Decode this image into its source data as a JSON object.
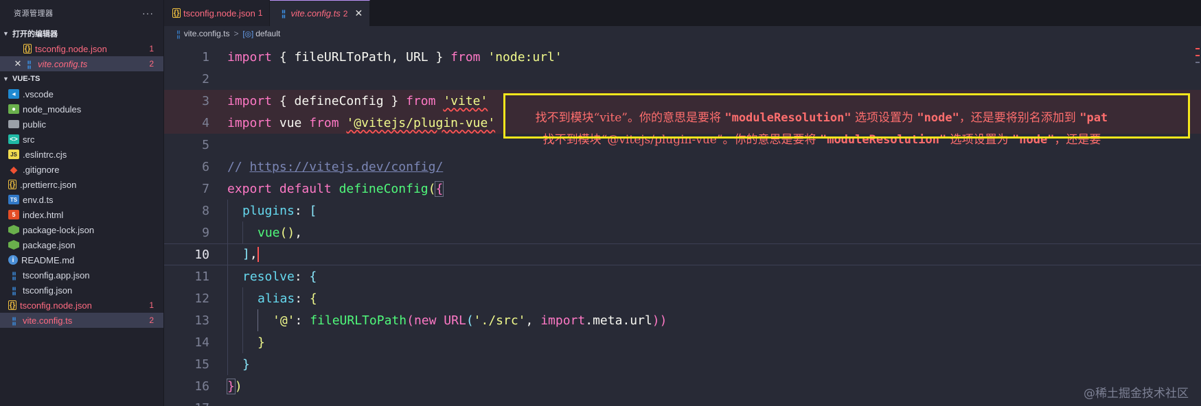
{
  "sidebar": {
    "title": "资源管理器",
    "more_icon": "···",
    "open_editors": {
      "label": "打开的编辑器",
      "items": [
        {
          "name": "tsconfig.node.json",
          "badge": "1",
          "icon": "json-icon",
          "glyph": "{}",
          "style": "err"
        },
        {
          "name": "vite.config.ts",
          "badge": "2",
          "icon": "tsconfig-icon",
          "glyph": "¦¦",
          "style": "err italic",
          "active": true,
          "close": "✕"
        }
      ]
    },
    "project": {
      "label": "VUE-TS",
      "items": [
        {
          "name": ".vscode",
          "icon": "vscode-icon",
          "glyph": "◂"
        },
        {
          "name": "node_modules",
          "icon": "node-modules-icon",
          "glyph": "●"
        },
        {
          "name": "public",
          "icon": "folder-icon",
          "glyph": ""
        },
        {
          "name": "src",
          "icon": "src-folder-icon",
          "glyph": "<>"
        },
        {
          "name": ".eslintrc.cjs",
          "icon": "js-icon",
          "glyph": "JS"
        },
        {
          "name": ".gitignore",
          "icon": "git-icon",
          "glyph": "◆"
        },
        {
          "name": ".prettierrc.json",
          "icon": "json-icon",
          "glyph": "{}"
        },
        {
          "name": "env.d.ts",
          "icon": "typescript-icon",
          "glyph": "TS"
        },
        {
          "name": "index.html",
          "icon": "html-icon",
          "glyph": "5"
        },
        {
          "name": "package-lock.json",
          "icon": "npm-icon",
          "glyph": ""
        },
        {
          "name": "package.json",
          "icon": "npm-icon",
          "glyph": ""
        },
        {
          "name": "README.md",
          "icon": "info-icon",
          "glyph": "i"
        },
        {
          "name": "tsconfig.app.json",
          "icon": "tsconfig-icon",
          "glyph": "¦¦"
        },
        {
          "name": "tsconfig.json",
          "icon": "tsconfig-icon",
          "glyph": "¦¦"
        },
        {
          "name": "tsconfig.node.json",
          "icon": "json-icon",
          "glyph": "{}",
          "badge": "1",
          "style": "err"
        },
        {
          "name": "vite.config.ts",
          "icon": "tsconfig-icon",
          "glyph": "¦¦",
          "badge": "2",
          "style": "err",
          "active": true
        }
      ]
    }
  },
  "tabs": [
    {
      "name": "tsconfig.node.json",
      "badge": "1",
      "icon": "json-icon",
      "glyph": "{}",
      "active": false
    },
    {
      "name": "vite.config.ts",
      "badge": "2",
      "icon": "tsconfig-icon",
      "glyph": "¦¦",
      "active": true,
      "close": "✕"
    }
  ],
  "breadcrumb": {
    "file": "vite.config.ts",
    "separator": ">",
    "symbol_icon": "[◎]",
    "symbol": "default"
  },
  "editor": {
    "line_numbers": [
      "1",
      "2",
      "3",
      "4",
      "5",
      "6",
      "7",
      "8",
      "9",
      "10",
      "11",
      "12",
      "13",
      "14",
      "15",
      "16",
      "17"
    ],
    "current_line": "10",
    "code": {
      "l1": {
        "kw1": "import",
        "p1": " { ",
        "id1": "fileURLToPath",
        "p2": ", ",
        "id2": "URL",
        "p3": " } ",
        "kw2": "from",
        "sp": " ",
        "str": "'node:url'"
      },
      "l3": {
        "kw1": "import",
        "p1": " { ",
        "id1": "defineConfig",
        "p2": " } ",
        "kw2": "from",
        "sp": " ",
        "str": "'vite'"
      },
      "l4": {
        "kw1": "import",
        "p1": " ",
        "id1": "vue",
        "p2": " ",
        "kw2": "from",
        "sp": " ",
        "str": "'@vitejs/plugin-vue'"
      },
      "l6": {
        "slashes": "// ",
        "url": "https://vitejs.dev/config/"
      },
      "l7": {
        "kw1": "export",
        "sp1": " ",
        "kw2": "default",
        "sp2": " ",
        "fn": "defineConfig",
        "p1": "(",
        "p2": "{"
      },
      "l8": {
        "prop": "plugins",
        "p": ": ",
        "b": "["
      },
      "l9": {
        "fn": "vue",
        "p": "()",
        "c": ","
      },
      "l10": {
        "b": "]",
        "c": ","
      },
      "l11": {
        "prop": "resolve",
        "p": ": ",
        "b": "{"
      },
      "l12": {
        "prop": "alias",
        "p": ": ",
        "b": "{"
      },
      "l13": {
        "key": "'@'",
        "p1": ": ",
        "fn": "fileURLToPath",
        "b1": "(",
        "kw": "new",
        "sp": " ",
        "cls": "URL",
        "b2": "(",
        "str": "'./src'",
        "c": ", ",
        "kw2": "import",
        "dot": ".",
        "meta": "meta",
        "dot2": ".",
        "url": "url",
        "b3": "))"
      },
      "l14": {
        "b": "}"
      },
      "l15": {
        "b": "}"
      },
      "l16": {
        "b1": "}",
        "b2": ")"
      }
    },
    "diagnostics": {
      "d1": {
        "pre": "找不到模块“vite”。你的意思是要将 ",
        "m1": "\"moduleResolution\"",
        "mid": " 选项设置为 ",
        "m2": "\"node\"",
        "post": "，还是要将别名添加到 ",
        "m3": "\"pat"
      },
      "d2": {
        "pre": "找不到模块“@vitejs/plugin-vue”。你的意思是要将 ",
        "m1": "\"moduleResolution\"",
        "mid": " 选项设置为 ",
        "m2": "\"node\"",
        "post": "，还是要"
      }
    }
  },
  "watermark": "@稀土掘金技术社区",
  "colors": {
    "error": "#ff6b81",
    "highlight_box": "#f5e61c",
    "accent": "#bd93f9"
  }
}
